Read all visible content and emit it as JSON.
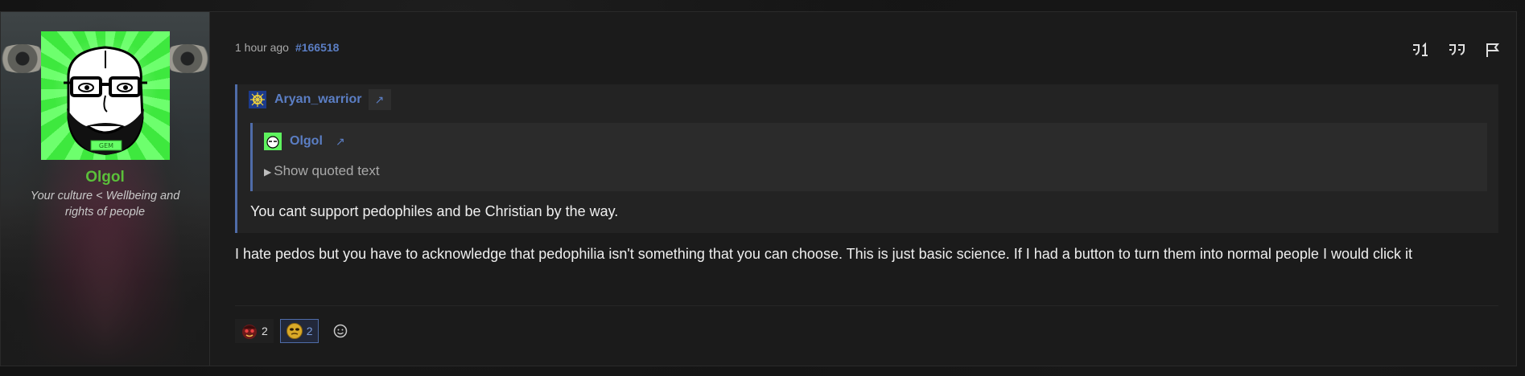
{
  "post": {
    "timestamp": "1 hour ago",
    "post_id": "#166518",
    "author": {
      "name": "Olgol",
      "title": "Your culture < Wellbeing and rights of people",
      "avatar_icon": "wojak-glasses-avatar",
      "avatar_badge": "GEM",
      "name_color": "#5bbf3a"
    },
    "toolbar": {
      "quote_single_icon": "quote-single-icon",
      "quote_icon": "quote-icon",
      "flag_icon": "flag-icon"
    },
    "quote": {
      "author": "Aryan_warrior",
      "jump_icon": "↗",
      "nested": {
        "author": "Olgol",
        "jump_icon": "↗",
        "show_quoted": "Show quoted text",
        "triangle": "▶"
      },
      "text": "You cant support pedophiles and be Christian by the way."
    },
    "body": "I hate pedos but you have to acknowledge that pedophilia isn't something that you can choose. This is just basic science. If I had a button to turn them into normal people I would click it",
    "reactions": [
      {
        "icon": "red-faced-emoji",
        "count": "2",
        "active": false
      },
      {
        "icon": "gold-faced-emoji",
        "count": "2",
        "active": true
      }
    ],
    "add_reaction_icon": "smiley-add-icon",
    "accent_color": "#4f6ca8",
    "link_color": "#5b7ec4"
  }
}
